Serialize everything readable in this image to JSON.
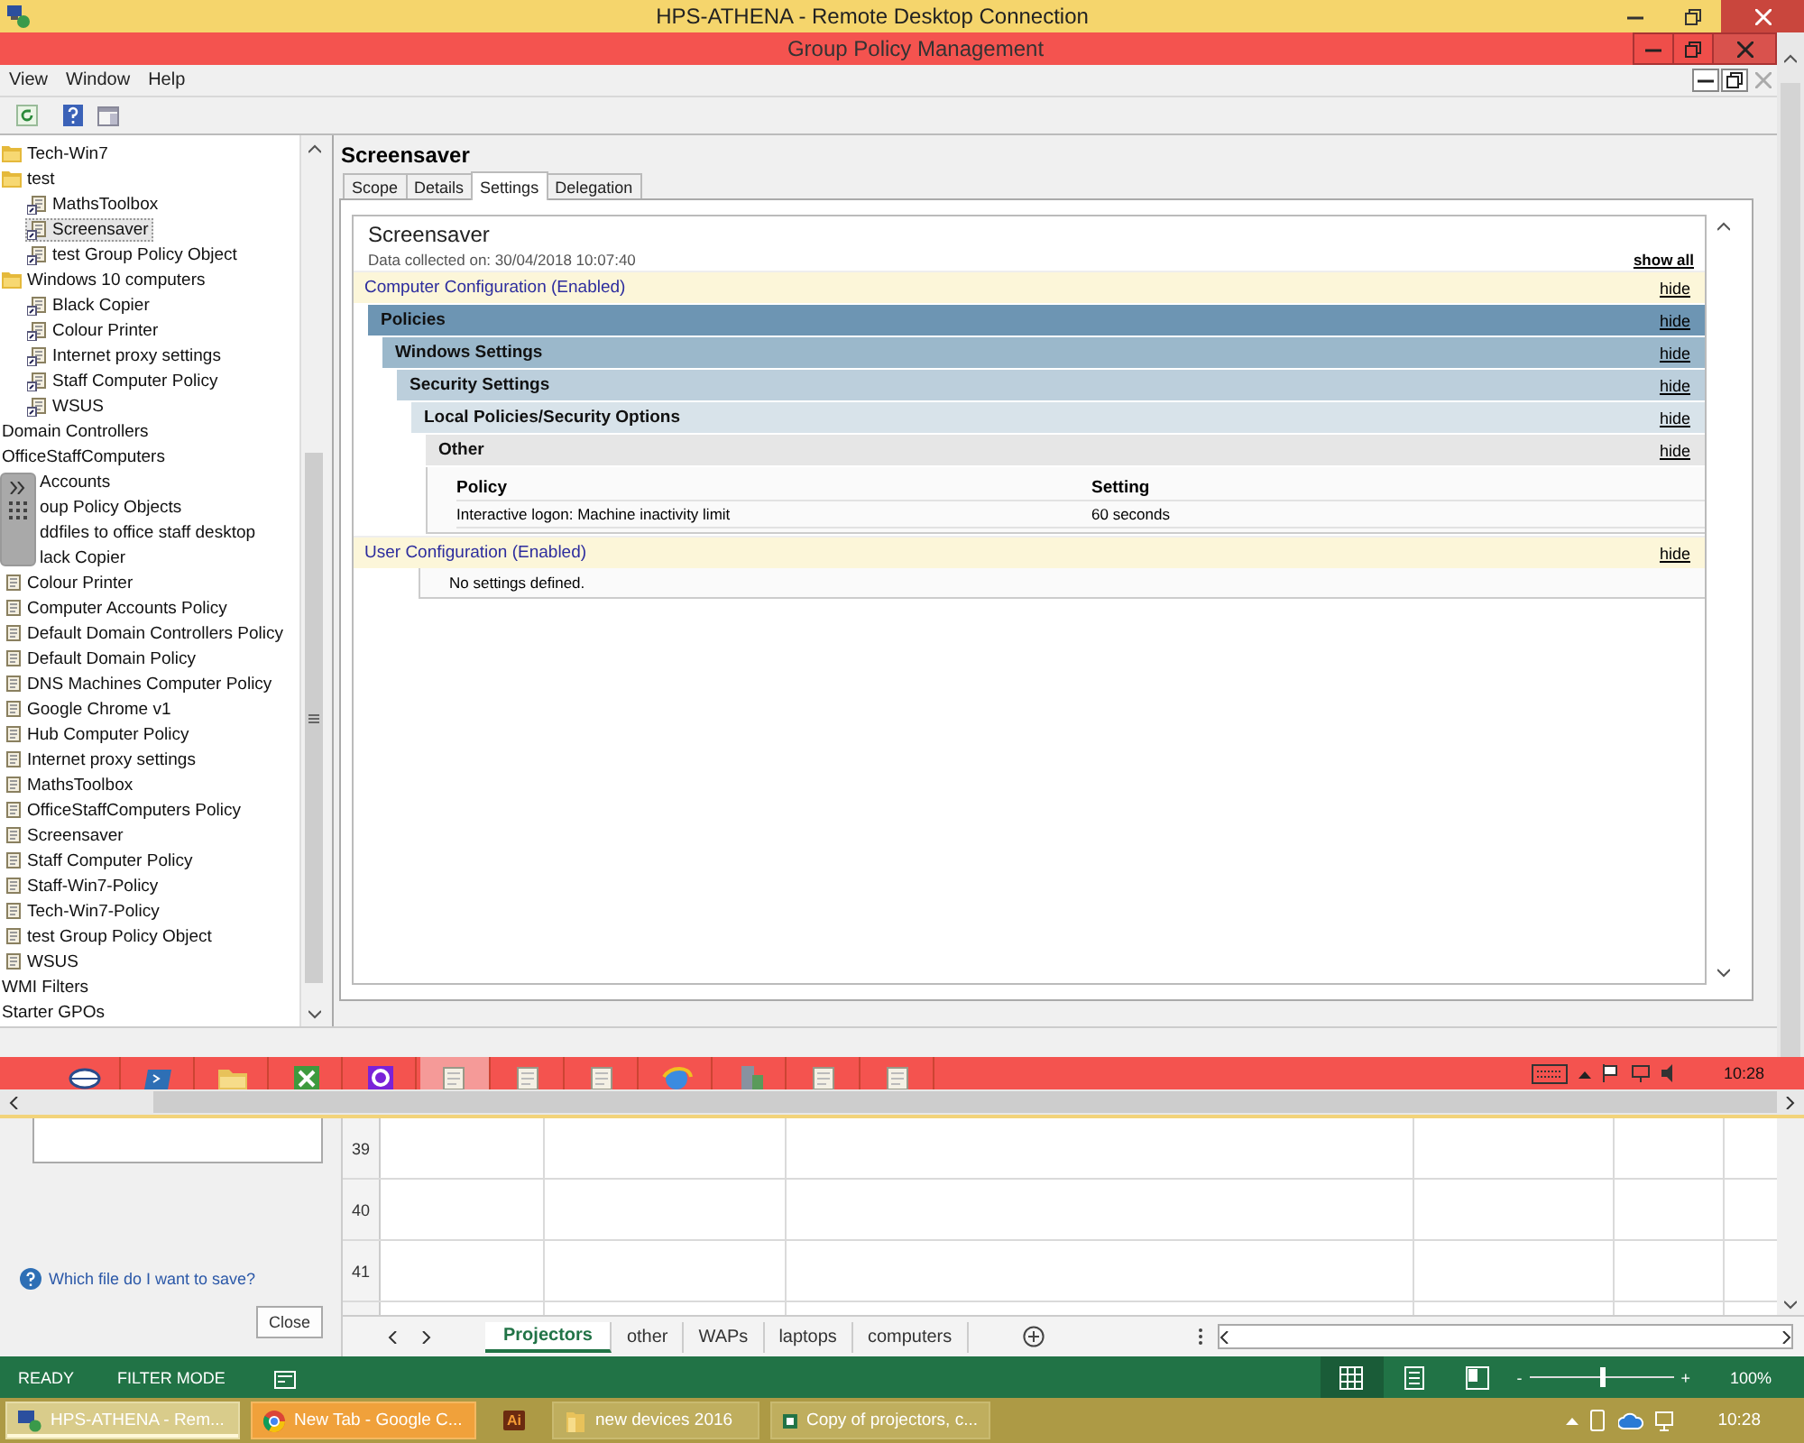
{
  "rdp_window": {
    "title": "HPS-ATHENA - Remote Desktop Connection"
  },
  "app_window": {
    "title": "Group Policy Management"
  },
  "menu": [
    "View",
    "Window",
    "Help"
  ],
  "tree": {
    "items": [
      {
        "label": "Tech-Win7",
        "kind": "folder",
        "selected": false
      },
      {
        "label": "test",
        "kind": "folder",
        "selected": false,
        "children": [
          {
            "label": "MathsToolbox",
            "kind": "link",
            "selected": false
          },
          {
            "label": "Screensaver",
            "kind": "link",
            "selected": true
          },
          {
            "label": "test Group Policy Object",
            "kind": "link",
            "selected": false
          }
        ]
      },
      {
        "label": "Windows 10 computers",
        "kind": "folder",
        "selected": false,
        "children": [
          {
            "label": "Black Copier",
            "kind": "link",
            "selected": false
          },
          {
            "label": "Colour Printer",
            "kind": "link",
            "selected": false
          },
          {
            "label": "Internet proxy settings",
            "kind": "link",
            "selected": false
          },
          {
            "label": "Staff Computer Policy",
            "kind": "link",
            "selected": false
          },
          {
            "label": "WSUS",
            "kind": "link",
            "selected": false
          }
        ]
      },
      {
        "label": "Domain Controllers",
        "kind": "container",
        "selected": false
      },
      {
        "label": "OfficeStaffComputers",
        "kind": "container",
        "selected": false
      },
      {
        "label": "Accounts",
        "kind": "container",
        "selected": false,
        "covered": true
      },
      {
        "label": "oup Policy Objects",
        "kind": "container",
        "selected": false,
        "covered": true,
        "children": [
          {
            "label": "ddfiles to office staff desktop",
            "kind": "gpo",
            "selected": false,
            "covered": true
          },
          {
            "label": "lack Copier",
            "kind": "gpo",
            "selected": false,
            "covered": true
          },
          {
            "label": "Colour Printer",
            "kind": "gpo",
            "selected": false
          },
          {
            "label": "Computer Accounts Policy",
            "kind": "gpo",
            "selected": false
          },
          {
            "label": "Default Domain Controllers Policy",
            "kind": "gpo",
            "selected": false
          },
          {
            "label": "Default Domain Policy",
            "kind": "gpo",
            "selected": false
          },
          {
            "label": "DNS Machines Computer Policy",
            "kind": "gpo",
            "selected": false
          },
          {
            "label": "Google Chrome v1",
            "kind": "gpo",
            "selected": false
          },
          {
            "label": "Hub Computer Policy",
            "kind": "gpo",
            "selected": false
          },
          {
            "label": "Internet proxy settings",
            "kind": "gpo",
            "selected": false
          },
          {
            "label": "MathsToolbox",
            "kind": "gpo",
            "selected": false
          },
          {
            "label": "OfficeStaffComputers  Policy",
            "kind": "gpo",
            "selected": false
          },
          {
            "label": "Screensaver",
            "kind": "gpo",
            "selected": false
          },
          {
            "label": "Staff Computer Policy",
            "kind": "gpo",
            "selected": false
          },
          {
            "label": "Staff-Win7-Policy",
            "kind": "gpo",
            "selected": false
          },
          {
            "label": "Tech-Win7-Policy",
            "kind": "gpo",
            "selected": false
          },
          {
            "label": "test Group Policy Object",
            "kind": "gpo",
            "selected": false
          },
          {
            "label": "WSUS",
            "kind": "gpo",
            "selected": false
          }
        ]
      },
      {
        "label": "WMI Filters",
        "kind": "container",
        "selected": false
      },
      {
        "label": "Starter GPOs",
        "kind": "container",
        "selected": false
      }
    ]
  },
  "policy_pane": {
    "title": "Screensaver",
    "tabs": [
      {
        "label": "Scope",
        "selected": false
      },
      {
        "label": "Details",
        "selected": false
      },
      {
        "label": "Settings",
        "selected": true
      },
      {
        "label": "Delegation",
        "selected": false
      }
    ],
    "report": {
      "title": "Screensaver",
      "collected": "Data collected on: 30/04/2018 10:07:40",
      "show_all": "show all",
      "sections": [
        {
          "title": "Computer Configuration (Enabled)",
          "hide": "hide",
          "children": [
            {
              "title": "Policies",
              "hide": "hide",
              "children": [
                {
                  "title": "Windows Settings",
                  "hide": "hide",
                  "children": [
                    {
                      "title": "Security Settings",
                      "hide": "hide",
                      "children": [
                        {
                          "title": "Local Policies/Security Options",
                          "hide": "hide",
                          "children": [
                            {
                              "title": "Other",
                              "hide": "hide",
                              "table": {
                                "columns": [
                                  "Policy",
                                  "Setting"
                                ],
                                "rows": [
                                  [
                                    "Interactive logon: Machine inactivity limit",
                                    "60 seconds"
                                  ]
                                ]
                              }
                            }
                          ]
                        }
                      ]
                    }
                  ]
                }
              ]
            }
          ]
        },
        {
          "title": "User Configuration (Enabled)",
          "hide": "hide",
          "note": "No settings defined."
        }
      ]
    }
  },
  "remote_taskbar": {
    "clock": "10:28"
  },
  "excel": {
    "help_link": "Which file do I want to save?",
    "close": "Close",
    "rows": [
      "39",
      "40",
      "41"
    ],
    "sheets": [
      {
        "label": "Projectors",
        "selected": true
      },
      {
        "label": "other",
        "selected": false
      },
      {
        "label": "WAPs",
        "selected": false
      },
      {
        "label": "laptops",
        "selected": false
      },
      {
        "label": "computers",
        "selected": false
      }
    ],
    "status": {
      "ready": "READY",
      "filter": "FILTER MODE",
      "views": [
        {
          "kind": "normal",
          "selected": true
        },
        {
          "kind": "page-layout",
          "selected": false
        },
        {
          "kind": "page-break",
          "selected": false
        }
      ],
      "zoom_minus": "-",
      "zoom_plus": "+",
      "zoom": {
        "level": 0.5
      },
      "zoom_percent": "100%"
    }
  },
  "taskbar": {
    "items": [
      {
        "label": "HPS-ATHENA - Rem...",
        "kind": "remote",
        "selected": true,
        "flashing": false
      },
      {
        "label": "New Tab - Google C...",
        "kind": "browser",
        "selected": false,
        "flashing": true
      },
      {
        "label": "Ai",
        "kind": "illustrator",
        "selected": false,
        "flashing": false
      },
      {
        "label": "new devices 2016",
        "kind": "folder",
        "selected": false,
        "flashing": false
      },
      {
        "label": "Copy of projectors, c...",
        "kind": "excel",
        "selected": false,
        "flashing": false
      }
    ],
    "clock": "10:28"
  }
}
